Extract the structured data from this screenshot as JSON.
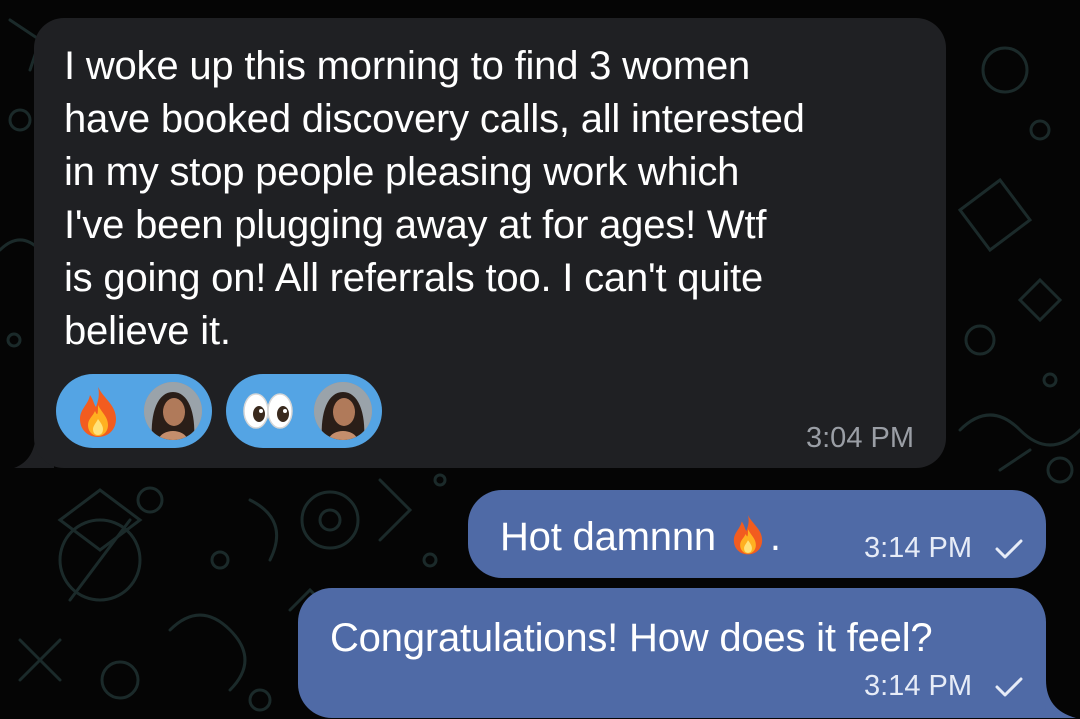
{
  "app": "Telegram chat",
  "colors": {
    "background": "#050505",
    "incoming_bubble": "#1f2023",
    "outgoing_bubble": "#4f6aa6",
    "reaction_pill": "#54a4e4",
    "timestamp_incoming": "#9a9ea5"
  },
  "messages": {
    "incoming": {
      "text": "I woke up this morning to find 3 women\nhave booked discovery calls, all interested\nin my stop people pleasing work which\nI've been plugging away at for ages! Wtf\nis going on! All referrals too. I can't quite\nbelieve it.",
      "time": "3:04 PM",
      "reactions": [
        {
          "emoji": "fire-emoji",
          "reactor": "avatar"
        },
        {
          "emoji": "eyes-emoji",
          "reactor": "avatar"
        }
      ]
    },
    "outgoing": [
      {
        "text": "Hot damnnn",
        "emoji": "fire-emoji",
        "suffix": ".",
        "time": "3:14 PM",
        "status": "sent-check"
      },
      {
        "text": "Congratulations! How does it feel?",
        "time": "3:14 PM",
        "status": "sent-check"
      }
    ]
  }
}
